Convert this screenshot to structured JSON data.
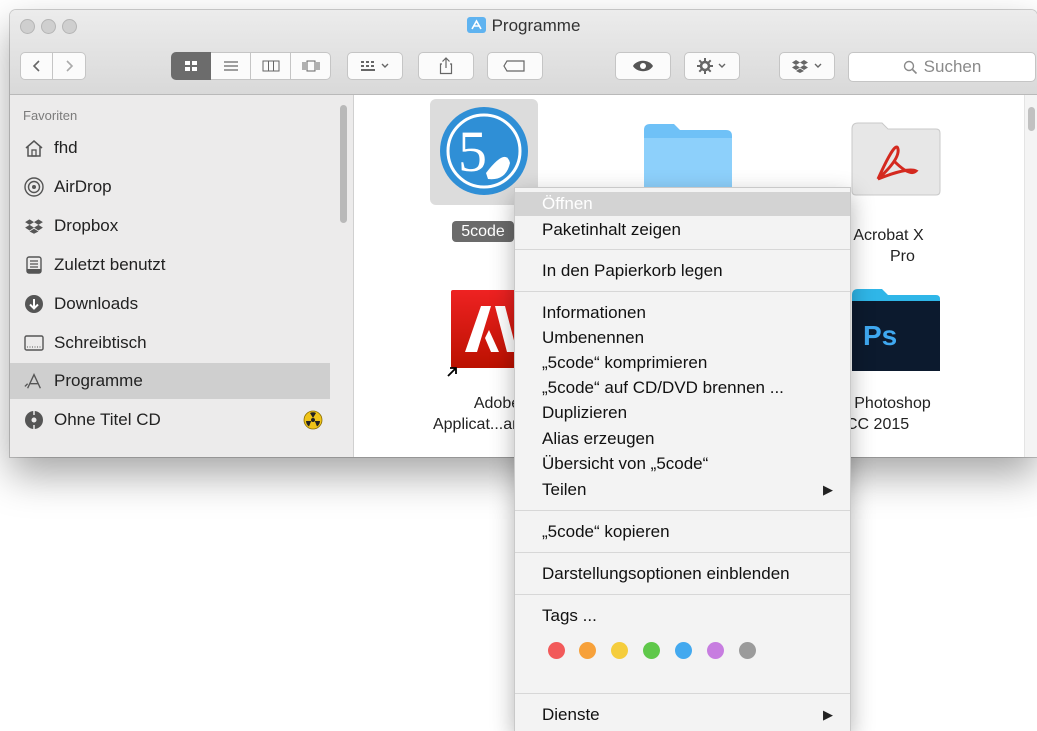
{
  "window": {
    "title": "Programme",
    "search_placeholder": "Suchen"
  },
  "sidebar": {
    "heading": "Favoriten",
    "items": [
      {
        "label": "fhd",
        "icon": "home-icon"
      },
      {
        "label": "AirDrop",
        "icon": "airdrop-icon"
      },
      {
        "label": "Dropbox",
        "icon": "dropbox-icon"
      },
      {
        "label": "Zuletzt benutzt",
        "icon": "recents-icon"
      },
      {
        "label": "Downloads",
        "icon": "downloads-icon"
      },
      {
        "label": "Schreibtisch",
        "icon": "desktop-icon"
      },
      {
        "label": "Programme",
        "icon": "applications-icon"
      },
      {
        "label": "Ohne Titel CD",
        "icon": "cd-icon"
      }
    ]
  },
  "files": {
    "fivecode": "5code",
    "acrobat_line1": "be Acrobat X",
    "acrobat_line2": "Pro",
    "adobe_apps_line1": "Adobe",
    "adobe_apps_line2": "Applicat...an",
    "photoshop_line1": "be Photoshop",
    "photoshop_line2": "CC 2015",
    "ps_badge": "Ps"
  },
  "context_menu": {
    "items": [
      "Öffnen",
      "Paketinhalt zeigen",
      "In den Papierkorb legen",
      "Informationen",
      "Umbenennen",
      "„5code“ komprimieren",
      "„5code“ auf CD/DVD brennen ...",
      "Duplizieren",
      "Alias erzeugen",
      "Übersicht von „5code“",
      "Teilen",
      "„5code“ kopieren",
      "Darstellungsoptionen einblenden",
      "Tags ...",
      "Dienste"
    ],
    "tag_colors": [
      "#f25a5a",
      "#f7a13a",
      "#f5cd3d",
      "#5fc84a",
      "#43a9ef",
      "#c77de0",
      "#9b9b9b"
    ]
  }
}
